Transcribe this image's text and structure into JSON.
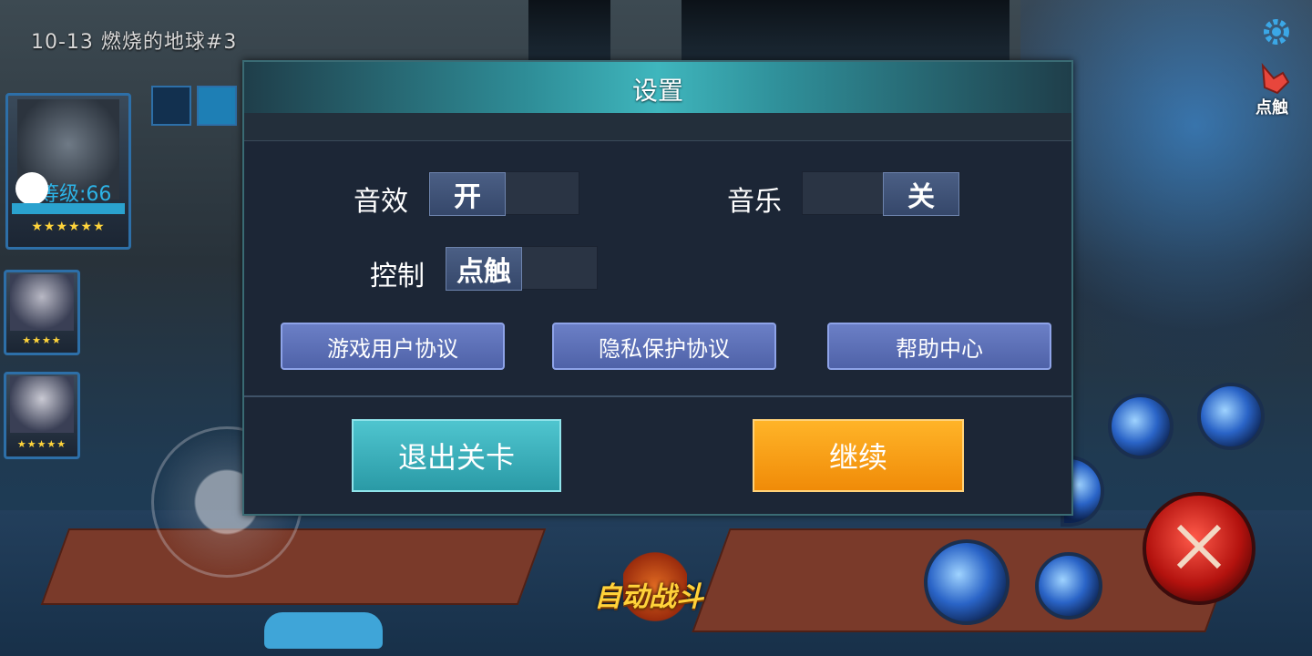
{
  "hud": {
    "stage_title": "10-13 燃烧的地球#3",
    "hero_level": "等级:66",
    "hero_stars": "★★★★★★",
    "ally1_stars": "★★★★",
    "ally2_stars": "★★★★★",
    "touch_label": "点触",
    "auto_battle": "自动战斗"
  },
  "dialog": {
    "title": "设置",
    "sound_label": "音效",
    "sound_value": "开",
    "music_label": "音乐",
    "music_value": "关",
    "control_label": "控制",
    "control_value": "点触",
    "links": [
      "游戏用户协议",
      "隐私保护协议",
      "帮助中心"
    ],
    "exit_label": "退出关卡",
    "continue_label": "继续"
  },
  "colors": {
    "header_accent": "#3fb6bd",
    "link_button": "#5d70b8",
    "exit_button": "#2fa9b4",
    "continue_button": "#f5a019"
  },
  "icons": [
    "gear-icon",
    "touch-hand-icon",
    "skill-orb-icon",
    "attack-swords-icon"
  ]
}
